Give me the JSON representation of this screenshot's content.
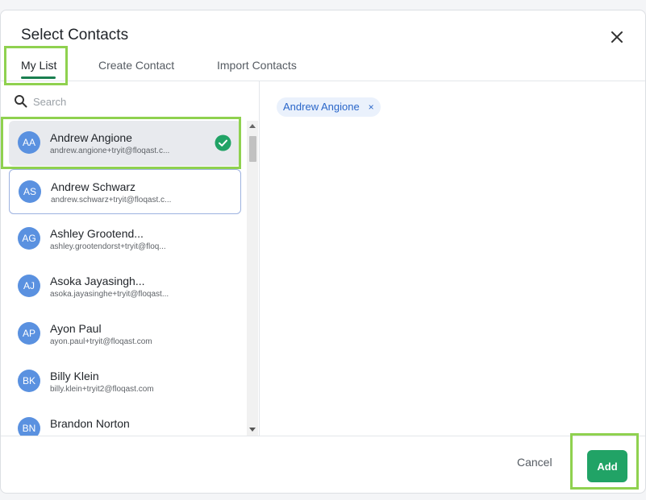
{
  "dialog": {
    "title": "Select Contacts",
    "close_icon": "close-icon"
  },
  "tabs": [
    {
      "label": "My List",
      "active": true
    },
    {
      "label": "Create Contact",
      "active": false
    },
    {
      "label": "Import Contacts",
      "active": false
    }
  ],
  "search": {
    "placeholder": "Search",
    "value": ""
  },
  "contacts": [
    {
      "initials": "AA",
      "name": "Andrew Angione",
      "email": "andrew.angione+tryit@floqast.c...",
      "selected": true
    },
    {
      "initials": "AS",
      "name": "Andrew Schwarz",
      "email": "andrew.schwarz+tryit@floqast.c...",
      "selected": false
    },
    {
      "initials": "AG",
      "name": "Ashley Grootend...",
      "email": "ashley.grootendorst+tryit@floq...",
      "selected": false
    },
    {
      "initials": "AJ",
      "name": "Asoka Jayasingh...",
      "email": "asoka.jayasinghe+tryit@floqast...",
      "selected": false
    },
    {
      "initials": "AP",
      "name": "Ayon Paul",
      "email": "ayon.paul+tryit@floqast.com",
      "selected": false
    },
    {
      "initials": "BK",
      "name": "Billy Klein",
      "email": "billy.klein+tryit2@floqast.com",
      "selected": false
    },
    {
      "initials": "BN",
      "name": "Brandon Norton",
      "email": "",
      "selected": false
    }
  ],
  "selected_chips": [
    {
      "label": "Andrew Angione",
      "remove_label": "×"
    }
  ],
  "footer": {
    "cancel_label": "Cancel",
    "add_label": "Add"
  },
  "colors": {
    "accent": "#21a366",
    "avatar": "#5a91e0",
    "chip_text": "#2a66c9",
    "highlight": "#8fd14f"
  }
}
